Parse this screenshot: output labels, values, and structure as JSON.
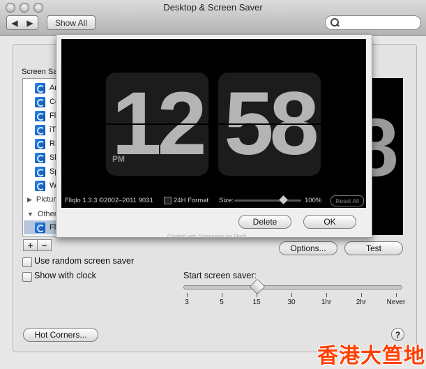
{
  "window": {
    "title": "Desktop & Screen Saver"
  },
  "toolbar": {
    "back_icon": "back-arrow-icon",
    "forward_icon": "forward-arrow-icon",
    "show_all_label": "Show All",
    "search_placeholder": ""
  },
  "screen_savers": {
    "label": "Screen Sav",
    "items": [
      "Ar",
      "Co",
      "Fl",
      "iT",
      "RS",
      "Sh",
      "Sp",
      "W"
    ],
    "groups": [
      "Pictur",
      "Other"
    ],
    "selected_item": "Fliqlo"
  },
  "list_buttons": {
    "add_label": "+",
    "remove_label": "−"
  },
  "panel_buttons": {
    "options_label": "Options...",
    "test_label": "Test",
    "hot_corners_label": "Hot Corners...",
    "help_label": "?"
  },
  "options": {
    "random_label": "Use random screen saver",
    "random_checked": false,
    "clock_label": "Show with clock",
    "clock_checked": false
  },
  "start_saver": {
    "label": "Start screen saver:",
    "ticks": [
      "3",
      "5",
      "15",
      "30",
      "1hr",
      "2hr",
      "Never"
    ],
    "selected": "15"
  },
  "preview": {
    "digit_fragment": "8"
  },
  "fliqlo_sheet": {
    "hour": "12",
    "minute": "58",
    "ampm": "PM",
    "credit": "Fliqlo 1.3.3 ©2002–2011 9031",
    "format_label": "24H Format",
    "format_checked": false,
    "size_label": "Size:",
    "size_value": "100%",
    "size_level": 1.0,
    "reset_label": "Reset All",
    "created_label": "Created with Screentime for Flash",
    "delete_label": "Delete",
    "ok_label": "OK"
  },
  "watermark": "香港大笪地",
  "colors": {
    "watermark": "#ff4000",
    "selection": "#b7c6dc",
    "screensaver_icon": "#1d6bd0"
  }
}
